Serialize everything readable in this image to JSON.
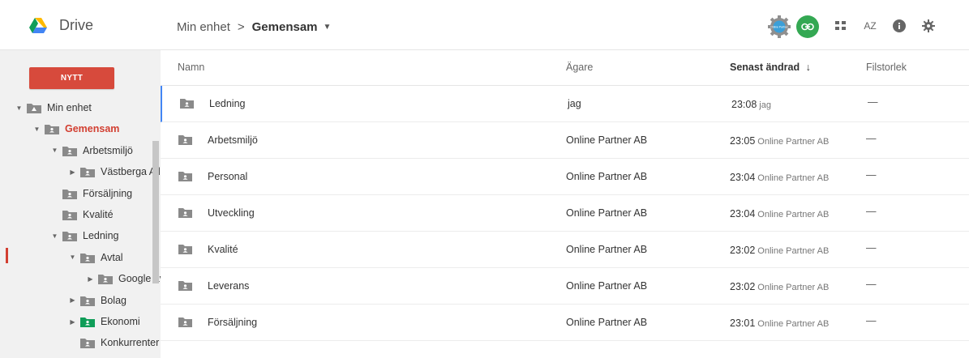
{
  "header": {
    "app_name": "Drive",
    "breadcrumb": {
      "root": "Min enhet",
      "separator": ">",
      "current": "Gemensam"
    },
    "toolbar_icons": [
      "addon-gear-icon",
      "link-sharing-icon",
      "grid-view-icon",
      "sort-az-icon",
      "info-icon",
      "settings-icon"
    ],
    "addon_badge_text": "Online Partner",
    "sort_label": "AZ"
  },
  "sidebar": {
    "new_button": "NYTT",
    "tree": [
      {
        "label": "Min enhet",
        "level": 0,
        "arrow": "▼",
        "icon": "drive-folder"
      },
      {
        "label": "Gemensam",
        "level": 1,
        "arrow": "▼",
        "icon": "shared-folder",
        "active": true
      },
      {
        "label": "Arbetsmiljö",
        "level": 2,
        "arrow": "▼",
        "icon": "shared-folder"
      },
      {
        "label": "Västberga All",
        "level": 3,
        "arrow": "▶",
        "icon": "shared-folder"
      },
      {
        "label": "Försäljning",
        "level": 2,
        "arrow": "",
        "icon": "shared-folder"
      },
      {
        "label": "Kvalité",
        "level": 2,
        "arrow": "",
        "icon": "shared-folder"
      },
      {
        "label": "Ledning",
        "level": 2,
        "arrow": "▼",
        "icon": "shared-folder"
      },
      {
        "label": "Avtal",
        "level": 3,
        "arrow": "▼",
        "icon": "shared-folder"
      },
      {
        "label": "Google avt",
        "level": 4,
        "arrow": "▶",
        "icon": "shared-folder"
      },
      {
        "label": "Bolag",
        "level": 3,
        "arrow": "▶",
        "icon": "shared-folder"
      },
      {
        "label": "Ekonomi",
        "level": 3,
        "arrow": "▶",
        "icon": "shared-folder-green"
      },
      {
        "label": "Konkurrenter",
        "level": 3,
        "arrow": "",
        "icon": "shared-folder"
      }
    ]
  },
  "file_list": {
    "columns": {
      "name": "Namn",
      "owner": "Ägare",
      "modified": "Senast ändrad",
      "modified_sort_icon": "↓",
      "size": "Filstorlek"
    },
    "rows": [
      {
        "name": "Ledning",
        "owner": "jag",
        "time": "23:08",
        "by": "jag",
        "size": "—"
      },
      {
        "name": "Arbetsmiljö",
        "owner": "Online Partner AB",
        "time": "23:05",
        "by": "Online Partner AB",
        "size": "—"
      },
      {
        "name": "Personal",
        "owner": "Online Partner AB",
        "time": "23:04",
        "by": "Online Partner AB",
        "size": "—"
      },
      {
        "name": "Utveckling",
        "owner": "Online Partner AB",
        "time": "23:04",
        "by": "Online Partner AB",
        "size": "—"
      },
      {
        "name": "Kvalité",
        "owner": "Online Partner AB",
        "time": "23:02",
        "by": "Online Partner AB",
        "size": "—"
      },
      {
        "name": "Leverans",
        "owner": "Online Partner AB",
        "time": "23:02",
        "by": "Online Partner AB",
        "size": "—"
      },
      {
        "name": "Försäljning",
        "owner": "Online Partner AB",
        "time": "23:01",
        "by": "Online Partner AB",
        "size": "—"
      }
    ]
  },
  "colors": {
    "accent_red": "#d74a3c",
    "active_red": "#d23f31",
    "link_green": "#34a853",
    "selection_blue": "#4285f4",
    "folder_grey": "#8a8a8a",
    "folder_green": "#0f9d58"
  }
}
